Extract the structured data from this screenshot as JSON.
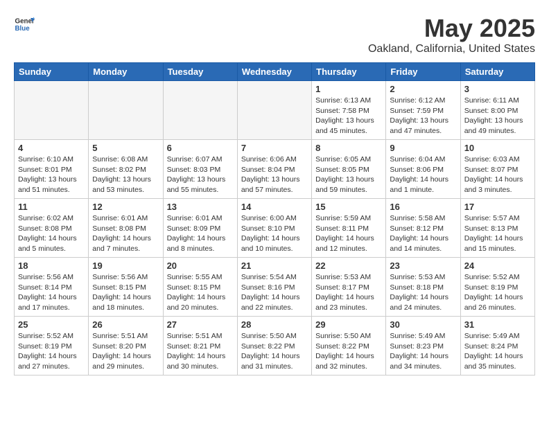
{
  "header": {
    "logo_general": "General",
    "logo_blue": "Blue",
    "month_title": "May 2025",
    "location": "Oakland, California, United States"
  },
  "days_of_week": [
    "Sunday",
    "Monday",
    "Tuesday",
    "Wednesday",
    "Thursday",
    "Friday",
    "Saturday"
  ],
  "weeks": [
    [
      {
        "day": "",
        "info": ""
      },
      {
        "day": "",
        "info": ""
      },
      {
        "day": "",
        "info": ""
      },
      {
        "day": "",
        "info": ""
      },
      {
        "day": "1",
        "info": "Sunrise: 6:13 AM\nSunset: 7:58 PM\nDaylight: 13 hours\nand 45 minutes."
      },
      {
        "day": "2",
        "info": "Sunrise: 6:12 AM\nSunset: 7:59 PM\nDaylight: 13 hours\nand 47 minutes."
      },
      {
        "day": "3",
        "info": "Sunrise: 6:11 AM\nSunset: 8:00 PM\nDaylight: 13 hours\nand 49 minutes."
      }
    ],
    [
      {
        "day": "4",
        "info": "Sunrise: 6:10 AM\nSunset: 8:01 PM\nDaylight: 13 hours\nand 51 minutes."
      },
      {
        "day": "5",
        "info": "Sunrise: 6:08 AM\nSunset: 8:02 PM\nDaylight: 13 hours\nand 53 minutes."
      },
      {
        "day": "6",
        "info": "Sunrise: 6:07 AM\nSunset: 8:03 PM\nDaylight: 13 hours\nand 55 minutes."
      },
      {
        "day": "7",
        "info": "Sunrise: 6:06 AM\nSunset: 8:04 PM\nDaylight: 13 hours\nand 57 minutes."
      },
      {
        "day": "8",
        "info": "Sunrise: 6:05 AM\nSunset: 8:05 PM\nDaylight: 13 hours\nand 59 minutes."
      },
      {
        "day": "9",
        "info": "Sunrise: 6:04 AM\nSunset: 8:06 PM\nDaylight: 14 hours\nand 1 minute."
      },
      {
        "day": "10",
        "info": "Sunrise: 6:03 AM\nSunset: 8:07 PM\nDaylight: 14 hours\nand 3 minutes."
      }
    ],
    [
      {
        "day": "11",
        "info": "Sunrise: 6:02 AM\nSunset: 8:08 PM\nDaylight: 14 hours\nand 5 minutes."
      },
      {
        "day": "12",
        "info": "Sunrise: 6:01 AM\nSunset: 8:08 PM\nDaylight: 14 hours\nand 7 minutes."
      },
      {
        "day": "13",
        "info": "Sunrise: 6:01 AM\nSunset: 8:09 PM\nDaylight: 14 hours\nand 8 minutes."
      },
      {
        "day": "14",
        "info": "Sunrise: 6:00 AM\nSunset: 8:10 PM\nDaylight: 14 hours\nand 10 minutes."
      },
      {
        "day": "15",
        "info": "Sunrise: 5:59 AM\nSunset: 8:11 PM\nDaylight: 14 hours\nand 12 minutes."
      },
      {
        "day": "16",
        "info": "Sunrise: 5:58 AM\nSunset: 8:12 PM\nDaylight: 14 hours\nand 14 minutes."
      },
      {
        "day": "17",
        "info": "Sunrise: 5:57 AM\nSunset: 8:13 PM\nDaylight: 14 hours\nand 15 minutes."
      }
    ],
    [
      {
        "day": "18",
        "info": "Sunrise: 5:56 AM\nSunset: 8:14 PM\nDaylight: 14 hours\nand 17 minutes."
      },
      {
        "day": "19",
        "info": "Sunrise: 5:56 AM\nSunset: 8:15 PM\nDaylight: 14 hours\nand 18 minutes."
      },
      {
        "day": "20",
        "info": "Sunrise: 5:55 AM\nSunset: 8:15 PM\nDaylight: 14 hours\nand 20 minutes."
      },
      {
        "day": "21",
        "info": "Sunrise: 5:54 AM\nSunset: 8:16 PM\nDaylight: 14 hours\nand 22 minutes."
      },
      {
        "day": "22",
        "info": "Sunrise: 5:53 AM\nSunset: 8:17 PM\nDaylight: 14 hours\nand 23 minutes."
      },
      {
        "day": "23",
        "info": "Sunrise: 5:53 AM\nSunset: 8:18 PM\nDaylight: 14 hours\nand 24 minutes."
      },
      {
        "day": "24",
        "info": "Sunrise: 5:52 AM\nSunset: 8:19 PM\nDaylight: 14 hours\nand 26 minutes."
      }
    ],
    [
      {
        "day": "25",
        "info": "Sunrise: 5:52 AM\nSunset: 8:19 PM\nDaylight: 14 hours\nand 27 minutes."
      },
      {
        "day": "26",
        "info": "Sunrise: 5:51 AM\nSunset: 8:20 PM\nDaylight: 14 hours\nand 29 minutes."
      },
      {
        "day": "27",
        "info": "Sunrise: 5:51 AM\nSunset: 8:21 PM\nDaylight: 14 hours\nand 30 minutes."
      },
      {
        "day": "28",
        "info": "Sunrise: 5:50 AM\nSunset: 8:22 PM\nDaylight: 14 hours\nand 31 minutes."
      },
      {
        "day": "29",
        "info": "Sunrise: 5:50 AM\nSunset: 8:22 PM\nDaylight: 14 hours\nand 32 minutes."
      },
      {
        "day": "30",
        "info": "Sunrise: 5:49 AM\nSunset: 8:23 PM\nDaylight: 14 hours\nand 34 minutes."
      },
      {
        "day": "31",
        "info": "Sunrise: 5:49 AM\nSunset: 8:24 PM\nDaylight: 14 hours\nand 35 minutes."
      }
    ]
  ]
}
